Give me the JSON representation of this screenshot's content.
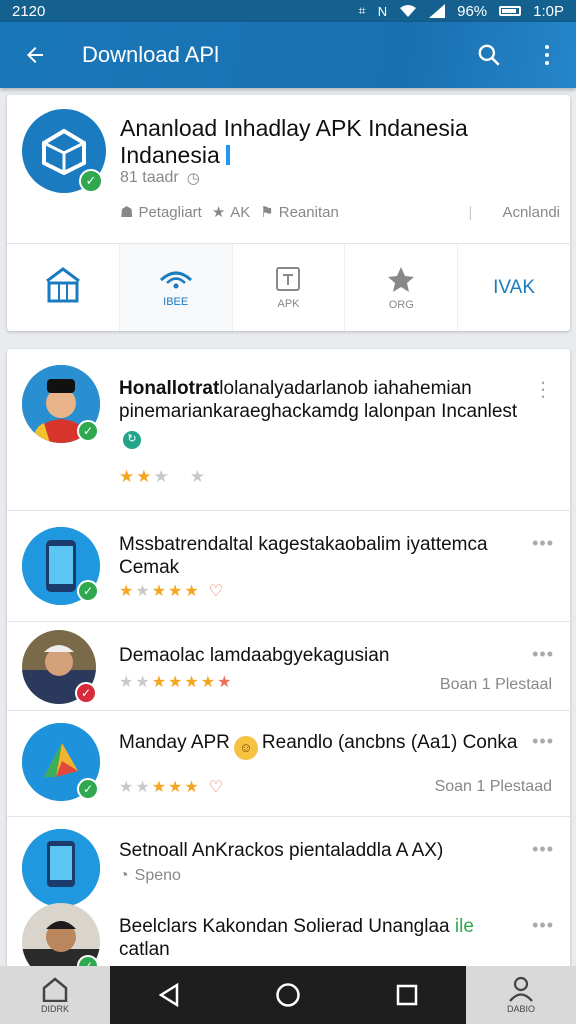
{
  "status_bar": {
    "time_left": "2120",
    "battery": "96%",
    "clock": "1:0P"
  },
  "app_bar": {
    "title": "Download APl"
  },
  "hero": {
    "title": "Ananload Inhadlay APK Indanesia Indanesia",
    "subtitle": "81 taadr",
    "meta_left_1": "Petagliart",
    "meta_left_2": "AK",
    "meta_left_3": "Reanitan",
    "meta_right": "Acnlandi",
    "categories": [
      {
        "label": ""
      },
      {
        "label": "IBEE"
      },
      {
        "label": "APK"
      },
      {
        "label": "ORG"
      },
      {
        "label": "IVAK"
      }
    ]
  },
  "apps": [
    {
      "title_bold": "Honallotrat",
      "title_rest": "lolanalyadarlanob iahahemian pinemariankaraeghackamdg lalonpan Incanlest",
      "rating": 2,
      "rating_max": 4,
      "right": ""
    },
    {
      "title": "Mssbatrendaltal kagestakaobalim iyattemca Cemak",
      "rating": 4,
      "rating_max": 5,
      "right": ""
    },
    {
      "title": "Demaolac lamdaabgyekagusian",
      "rating": 5,
      "rating_max": 6,
      "right": "Boan 1 Plestaal"
    },
    {
      "title_a": "Manday APR",
      "title_b": "Reandlo (ancbns (Aa1) Conka",
      "rating": 4,
      "rating_max": 5,
      "right": "Soan 1 Plestaad"
    },
    {
      "title": "Setnoall AnKrackos pientaladdla A AX)",
      "sub": "Speno",
      "right": ""
    },
    {
      "title_a": "Beelclars Kakondan Solierad Unanglaa",
      "title_green": "ile",
      "title_b": "catlan",
      "right": ""
    }
  ],
  "nav": {
    "left_label": "DIDRK",
    "right_label": "DABIO"
  },
  "colors": {
    "primary": "#1a78b8",
    "accent_green": "#2fa84f",
    "star": "#f4a623"
  }
}
